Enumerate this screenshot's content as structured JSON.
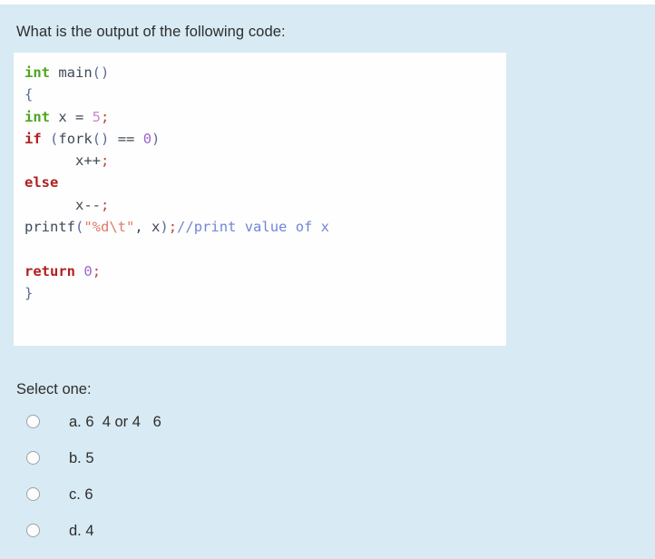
{
  "page": {
    "background_color": "#d8eaf3",
    "question": "What is the output of the following code:"
  },
  "code_block": {
    "background_color": "#fefefe",
    "language": "c",
    "plain_text": "int main()\n{\nint x = 5;\nif (fork() == 0)\n      x++;\nelse\n      x--;\nprintf(\"%d\\t\", x);//print value of x\n\nreturn 0;\n}",
    "lines": [
      {
        "tokens": [
          {
            "text": "int",
            "type": "kw-type"
          },
          {
            "text": " ",
            "type": "plain"
          },
          {
            "text": "main",
            "type": "ident"
          },
          {
            "text": "()",
            "type": "punc"
          }
        ]
      },
      {
        "tokens": [
          {
            "text": "{",
            "type": "punc"
          }
        ]
      },
      {
        "tokens": [
          {
            "text": "int",
            "type": "kw-type"
          },
          {
            "text": " x = ",
            "type": "plain"
          },
          {
            "text": "5",
            "type": "num-pink"
          },
          {
            "text": ";",
            "type": "semi"
          }
        ]
      },
      {
        "tokens": [
          {
            "text": "if",
            "type": "kw-ctrl"
          },
          {
            "text": " ",
            "type": "plain"
          },
          {
            "text": "(",
            "type": "punc"
          },
          {
            "text": "fork",
            "type": "ident"
          },
          {
            "text": "()",
            "type": "punc"
          },
          {
            "text": " == ",
            "type": "plain"
          },
          {
            "text": "0",
            "type": "num-purp"
          },
          {
            "text": ")",
            "type": "punc"
          }
        ]
      },
      {
        "tokens": [
          {
            "text": "      x++",
            "type": "plain"
          },
          {
            "text": ";",
            "type": "semi"
          }
        ]
      },
      {
        "tokens": [
          {
            "text": "else",
            "type": "kw-ctrl"
          }
        ]
      },
      {
        "tokens": [
          {
            "text": "      x--",
            "type": "plain"
          },
          {
            "text": ";",
            "type": "semi"
          }
        ]
      },
      {
        "tokens": [
          {
            "text": "printf",
            "type": "ident"
          },
          {
            "text": "(",
            "type": "punc"
          },
          {
            "text": "\"%d\\t\"",
            "type": "string"
          },
          {
            "text": ", ",
            "type": "plain"
          },
          {
            "text": "x",
            "type": "plain"
          },
          {
            "text": ")",
            "type": "punc"
          },
          {
            "text": ";",
            "type": "semi"
          },
          {
            "text": "//print value of x",
            "type": "comment"
          }
        ]
      },
      {
        "tokens": []
      },
      {
        "tokens": [
          {
            "text": "return",
            "type": "kw-ctrl"
          },
          {
            "text": " ",
            "type": "plain"
          },
          {
            "text": "0",
            "type": "num-purp"
          },
          {
            "text": ";",
            "type": "semi"
          }
        ]
      },
      {
        "tokens": [
          {
            "text": "}",
            "type": "punc"
          }
        ]
      }
    ],
    "colors": {
      "keyword_type": "#4ca61c",
      "keyword_control": "#b02020",
      "string": "#e07a6a",
      "comment": "#7186d8",
      "number_pink": "#cf86c4",
      "number_purple": "#9a68c8",
      "punctuation": "#5b6a9c",
      "plain": "#3f4a56",
      "semicolon": "#b8483a"
    }
  },
  "answers": {
    "prompt": "Select one:",
    "selected": null,
    "options": [
      {
        "id": "a",
        "label": "a. 6  4 or 4   6"
      },
      {
        "id": "b",
        "label": "b. 5"
      },
      {
        "id": "c",
        "label": "c. 6"
      },
      {
        "id": "d",
        "label": "d. 4"
      }
    ]
  }
}
